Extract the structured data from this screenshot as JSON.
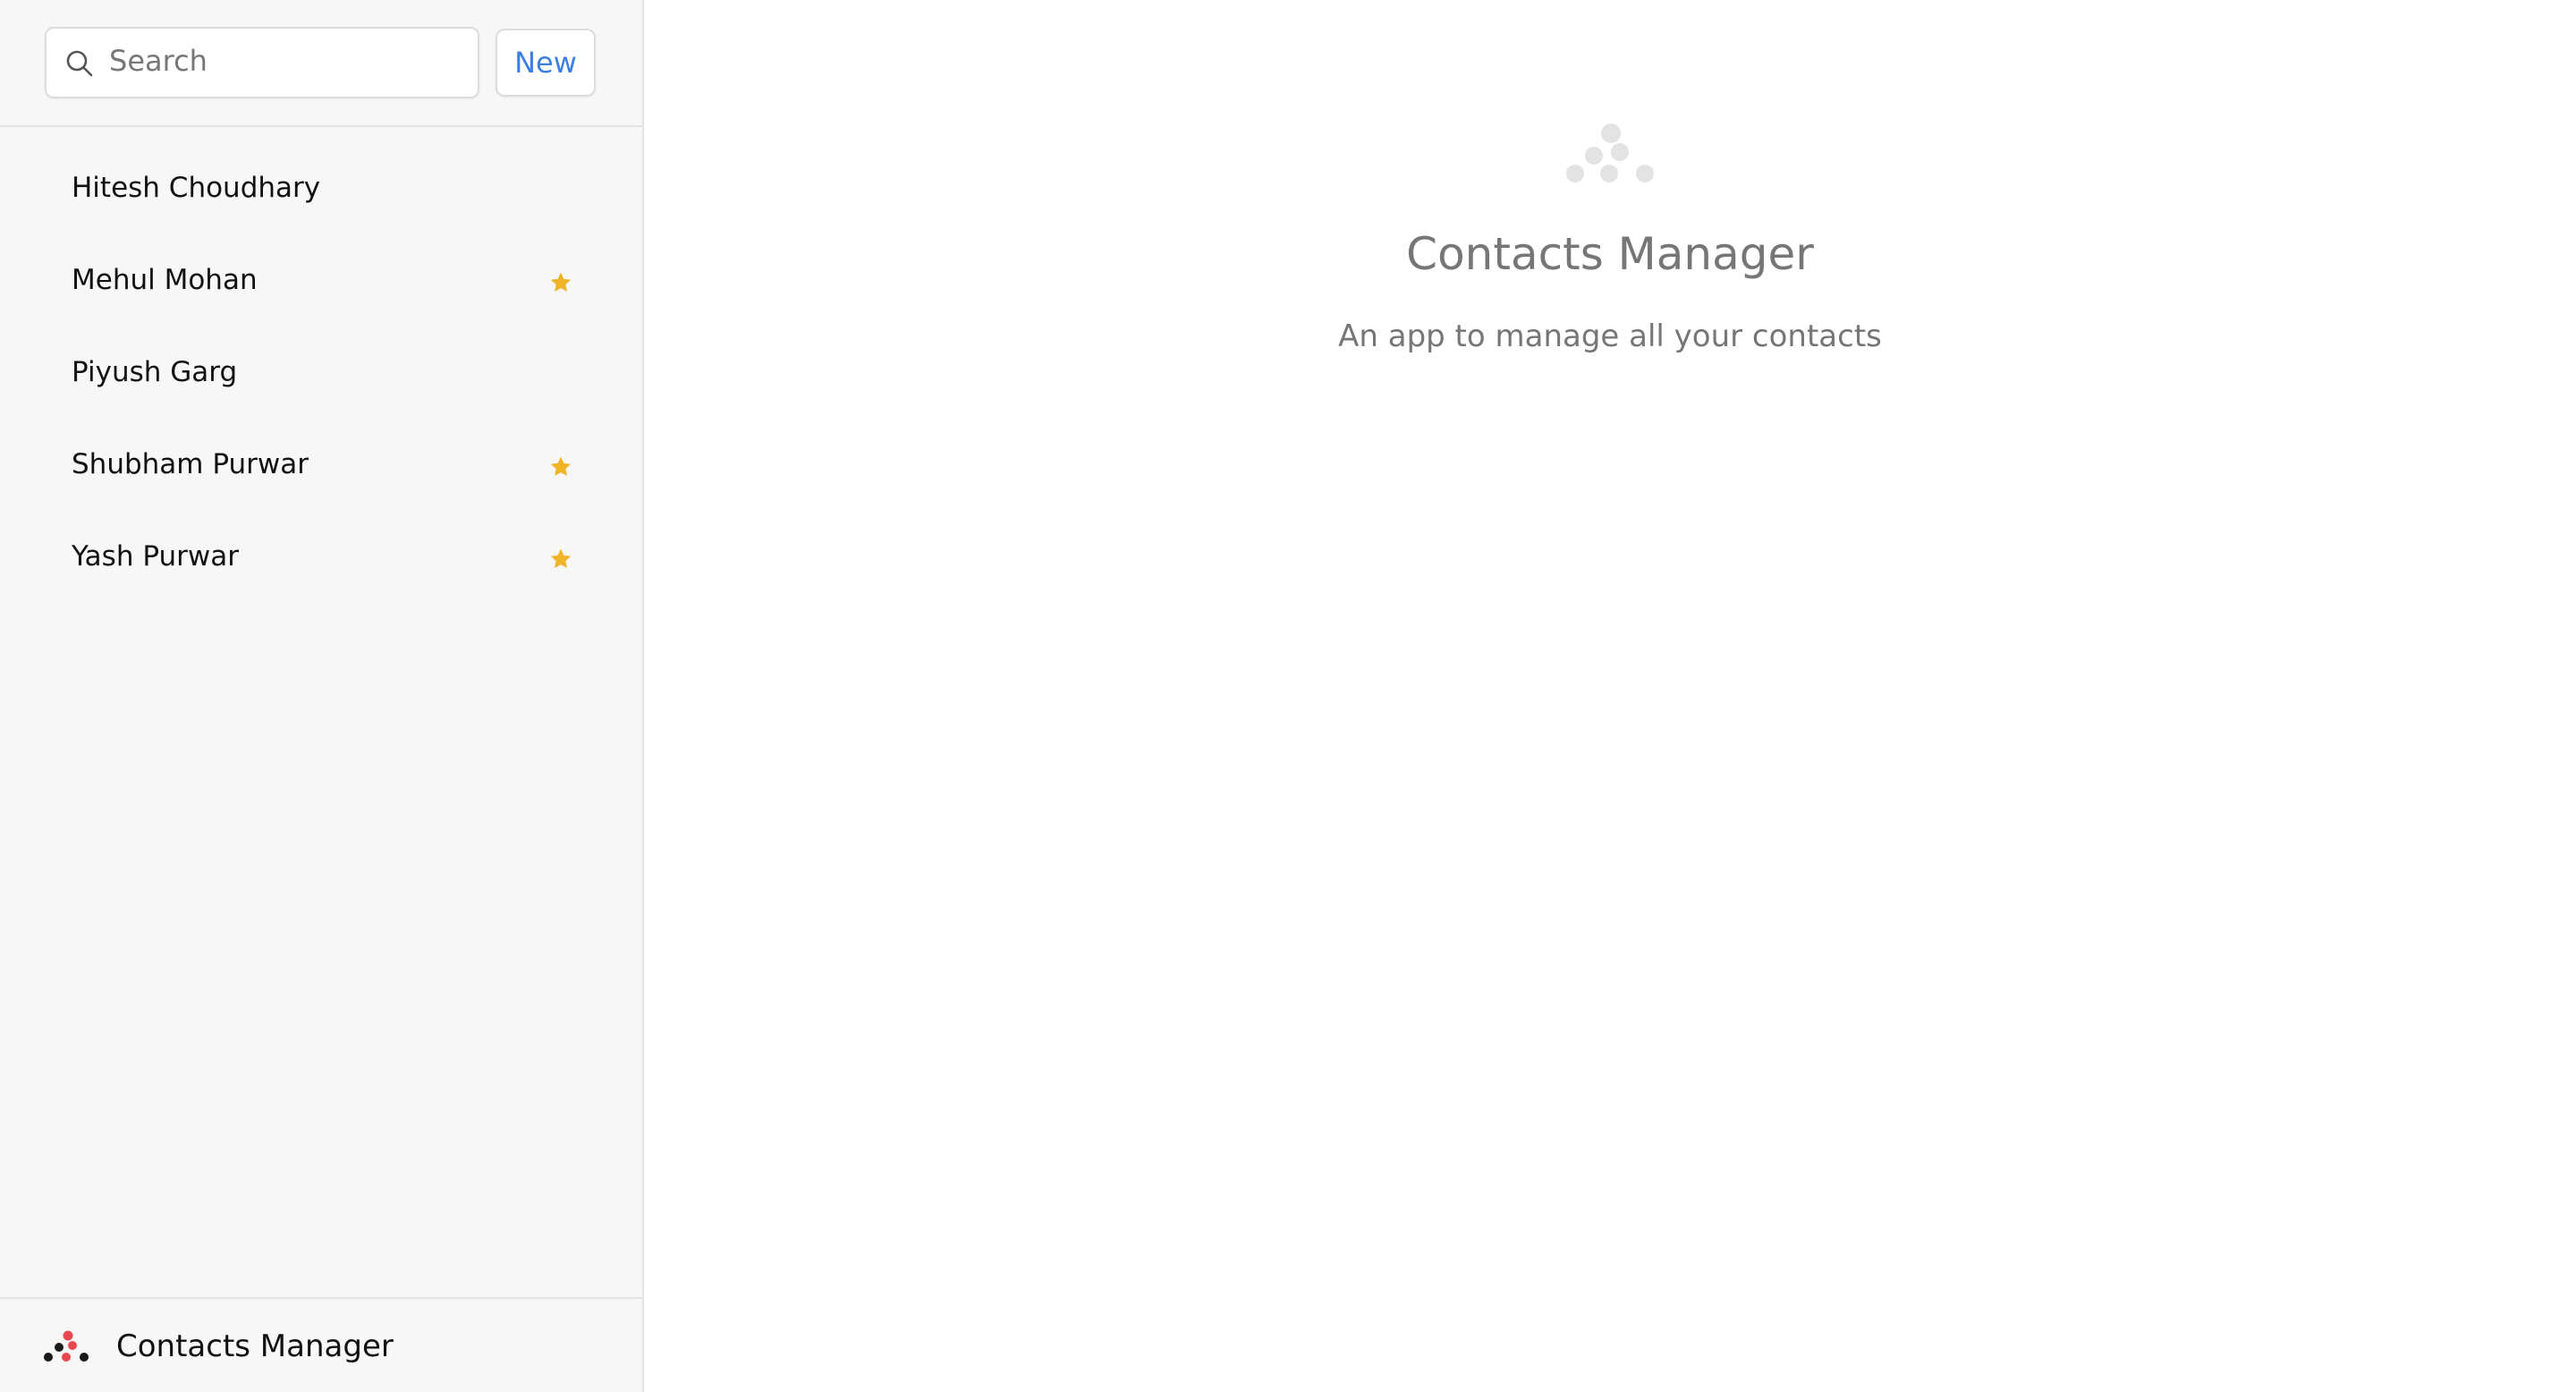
{
  "search": {
    "placeholder": "Search",
    "value": ""
  },
  "toolbar": {
    "new_label": "New"
  },
  "contacts": [
    {
      "name": "Hitesh Choudhary",
      "favorite": false
    },
    {
      "name": "Mehul Mohan",
      "favorite": true
    },
    {
      "name": "Piyush Garg",
      "favorite": false
    },
    {
      "name": "Shubham Purwar",
      "favorite": true
    },
    {
      "name": "Yash Purwar",
      "favorite": true
    }
  ],
  "footer": {
    "title": "Contacts Manager",
    "logo_icon": "contacts-logo-icon"
  },
  "main": {
    "title": "Contacts Manager",
    "subtitle": "An app to manage all your contacts",
    "logo_icon": "contacts-logo-icon"
  },
  "colors": {
    "accent": "#3b7fe0",
    "star": "#f0b429",
    "logo_dark": "#1a1a1a",
    "logo_red": "#e8484d",
    "hero_logo": "#e3e3e3"
  }
}
